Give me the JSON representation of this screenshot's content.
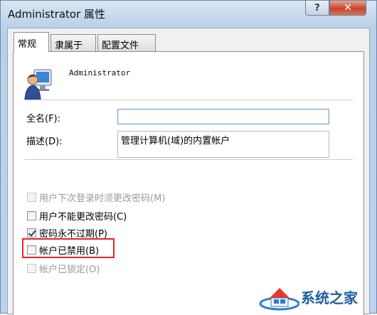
{
  "window": {
    "title": "Administrator 属性",
    "help_label": "?",
    "close_label": "✕"
  },
  "tabs": [
    {
      "label": "常规",
      "active": true
    },
    {
      "label": "隶属于",
      "active": false
    },
    {
      "label": "配置文件",
      "active": false
    }
  ],
  "general": {
    "username": "Administrator",
    "full_name_label": "全名(F):",
    "full_name_value": "",
    "description_label": "描述(D):",
    "description_value": "管理计算机(域)的内置帐户"
  },
  "options": [
    {
      "label": "用户下次登录时须更改密码(M)",
      "checked": false,
      "disabled": true
    },
    {
      "label": "用户不能更改密码(C)",
      "checked": false,
      "disabled": false
    },
    {
      "label": "密码永不过期(P)",
      "checked": true,
      "disabled": false
    },
    {
      "label": "帐户已禁用(B)",
      "checked": false,
      "disabled": false,
      "highlighted": true
    },
    {
      "label": "帐户已锁定(O)",
      "checked": false,
      "disabled": true
    }
  ],
  "colors": {
    "highlight_box": "#e0232e",
    "title_bar": "#c9dcee",
    "close_button": "#c7452c"
  },
  "watermark": {
    "logo_icon": "house-logo-icon",
    "text": "系统之家"
  }
}
